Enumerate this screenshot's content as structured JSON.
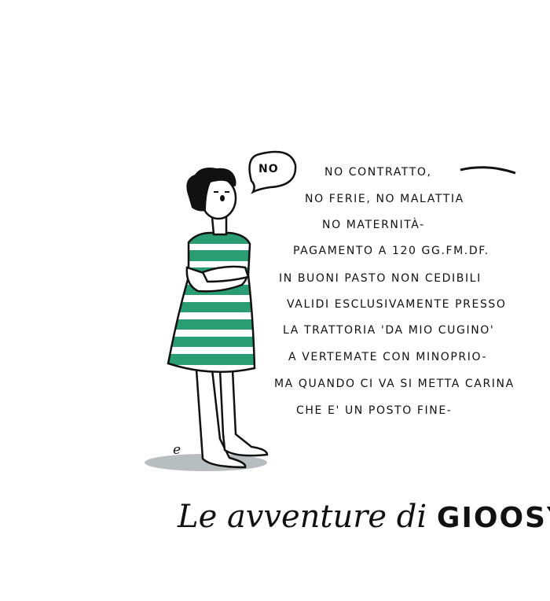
{
  "speech_bubble": {
    "text": "NO"
  },
  "speech_lines": [
    "NO CONTRATTO,",
    "NO FERIE, NO MALATTIA",
    "NO MATERNITÀ-",
    "PAGAMENTO A 120 GG.FM.DF.",
    "IN BUONI PASTO NON CEDIBILI",
    "VALIDI ESCLUSIVAMENTE PRESSO",
    "LA TRATTORIA 'DA MIO CUGINO'",
    "A VERTEMATE CON MINOPRIO-",
    "MA QUANDO CI VA SI METTA CARINA",
    "CHE E' UN POSTO FINE-"
  ],
  "signature": "e",
  "title": {
    "prefix": "Le avventure di",
    "name": "GIOOSY"
  },
  "colors": {
    "stripe_green": "#2a9d72",
    "shadow": "#b8bdc0",
    "ink": "#111111"
  }
}
